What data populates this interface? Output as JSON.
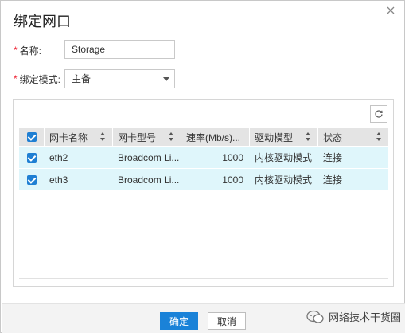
{
  "dialog": {
    "title": "绑定网口",
    "close_glyph": "×"
  },
  "form": {
    "required_mark": "*",
    "name_label": "名称:",
    "name_value": "Storage",
    "mode_label": "绑定模式:",
    "mode_value": "主备"
  },
  "table": {
    "columns": [
      "网卡名称",
      "网卡型号",
      "速率(Mb/s)...",
      "驱动模型",
      "状态"
    ],
    "rows": [
      {
        "checked": true,
        "name": "eth2",
        "model": "Broadcom Li...",
        "speed": "1000",
        "driver": "内核驱动模式",
        "status": "连接"
      },
      {
        "checked": true,
        "name": "eth3",
        "model": "Broadcom Li...",
        "speed": "1000",
        "driver": "内核驱动模式",
        "status": "连接"
      }
    ]
  },
  "footer": {
    "ok_label": "确定",
    "cancel_label": "取消"
  },
  "watermark": {
    "text": "网络技术干货圈"
  },
  "colors": {
    "accent": "#1a82d8",
    "row_bg": "#dff6fb",
    "header_bg": "#e4e4e4",
    "required": "#e23333"
  },
  "icons": {
    "refresh": "refresh-icon",
    "close": "close-icon",
    "dropdown": "chevron-down-icon",
    "sort": "sort-icon",
    "checkbox": "checkbox-checked-icon"
  }
}
